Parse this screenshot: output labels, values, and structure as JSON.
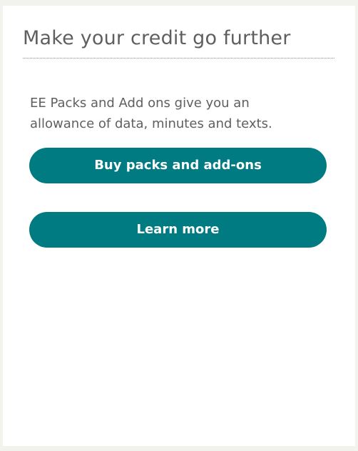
{
  "panel": {
    "title": "Make your credit go further",
    "description": "EE Packs and Add ons give you an allowance of data, minutes and texts.",
    "buttons": {
      "buy_label": "Buy packs and add-ons",
      "learn_label": "Learn more"
    }
  },
  "colors": {
    "accent": "#007b82",
    "text": "#5f5f5f",
    "page_background": "#f3f3ee",
    "card_background": "#ffffff"
  }
}
